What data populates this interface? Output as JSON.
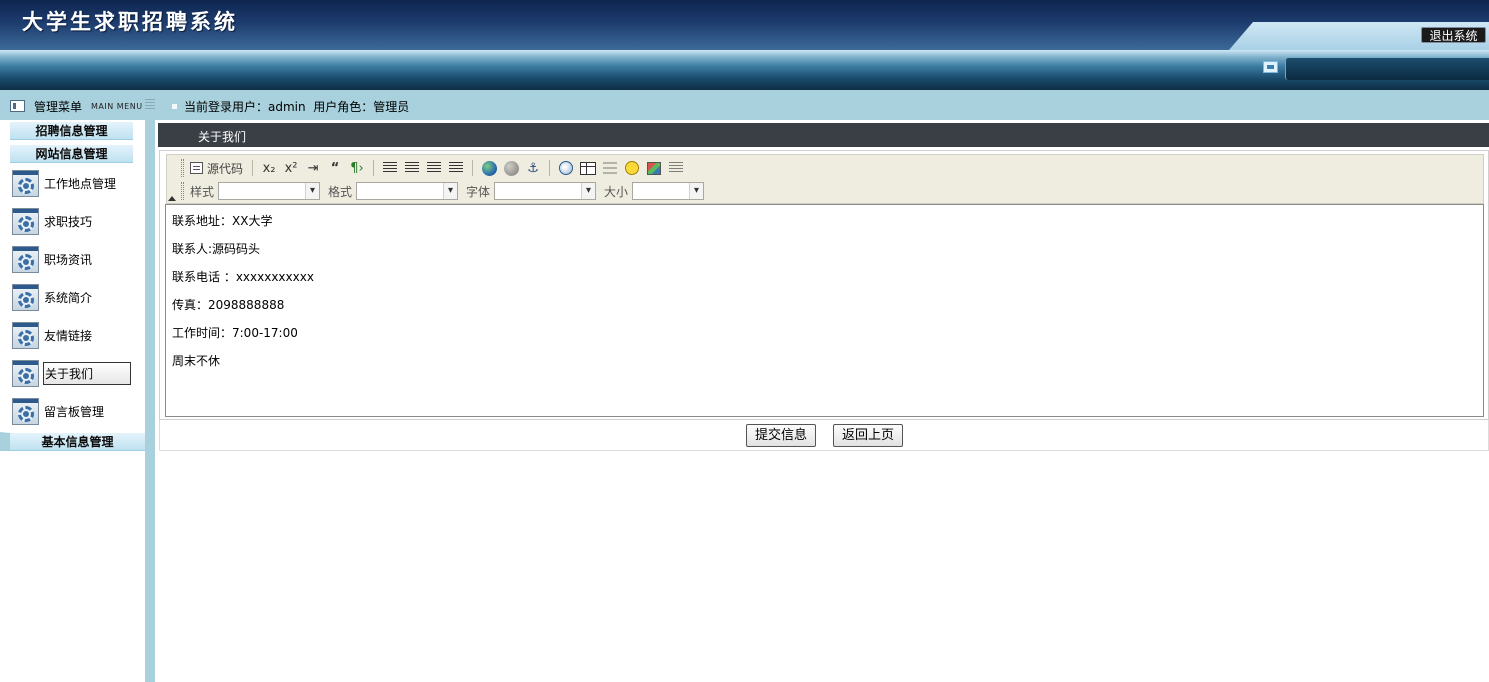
{
  "header": {
    "title": "大学生求职招聘系统",
    "logout_label": "退出系统"
  },
  "status": {
    "menu_title": "管理菜单",
    "menu_title_en": "MAIN MENU",
    "user_info": "当前登录用户：admin  用户角色：管理员"
  },
  "sidebar": {
    "groups": [
      {
        "label": "招聘信息管理"
      },
      {
        "label": "网站信息管理"
      },
      {
        "label": "基本信息管理"
      }
    ],
    "items": [
      {
        "label": "工作地点管理",
        "icon": "gear-icon"
      },
      {
        "label": "求职技巧",
        "icon": "gear-icon"
      },
      {
        "label": "职场资讯",
        "icon": "gear-icon"
      },
      {
        "label": "系统简介",
        "icon": "gear-icon"
      },
      {
        "label": "友情链接",
        "icon": "gear-icon"
      },
      {
        "label": "关于我们",
        "icon": "gear-icon",
        "active": true
      },
      {
        "label": "留言板管理",
        "icon": "gear-icon"
      }
    ]
  },
  "main": {
    "title": "关于我们",
    "toolbar": {
      "source_label": "源代码",
      "style_label": "样式",
      "format_label": "格式",
      "font_label": "字体",
      "size_label": "大小",
      "icons": [
        "source-icon",
        "subscript-icon",
        "superscript-icon",
        "indent-icon",
        "blockquote-icon",
        "bidi-icon",
        "align-left-icon",
        "align-center-icon",
        "align-right-icon",
        "align-justify-icon",
        "link-icon",
        "unlink-icon",
        "anchor-icon",
        "flash-icon",
        "table-icon",
        "hr-icon",
        "smiley-icon",
        "special-char-icon",
        "pagebreak-icon"
      ]
    },
    "content_lines": [
      "联系地址：XX大学",
      "联系人:源码码头",
      "联系电话 ：xxxxxxxxxxx",
      "传真：2098888888",
      "工作时间：7:00-17:00",
      "周末不休"
    ],
    "submit_label": "提交信息",
    "back_label": "返回上页"
  }
}
